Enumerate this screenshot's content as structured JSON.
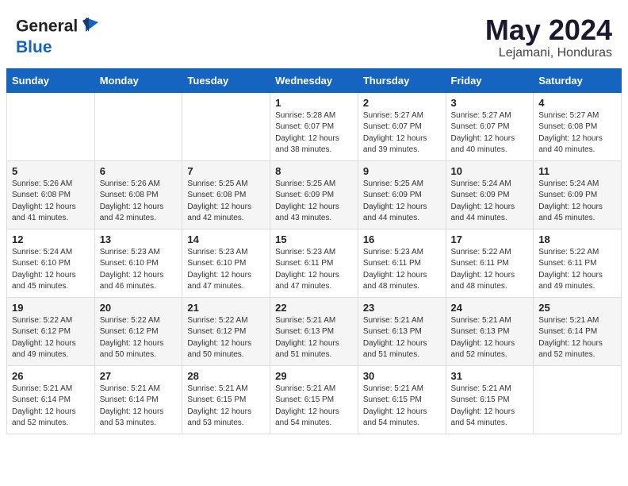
{
  "header": {
    "logo_line1": "General",
    "logo_line2": "Blue",
    "month_title": "May 2024",
    "location": "Lejamani, Honduras"
  },
  "weekdays": [
    "Sunday",
    "Monday",
    "Tuesday",
    "Wednesday",
    "Thursday",
    "Friday",
    "Saturday"
  ],
  "weeks": [
    [
      {
        "day": "",
        "sunrise": "",
        "sunset": "",
        "daylight": ""
      },
      {
        "day": "",
        "sunrise": "",
        "sunset": "",
        "daylight": ""
      },
      {
        "day": "",
        "sunrise": "",
        "sunset": "",
        "daylight": ""
      },
      {
        "day": "1",
        "sunrise": "Sunrise: 5:28 AM",
        "sunset": "Sunset: 6:07 PM",
        "daylight": "Daylight: 12 hours and 38 minutes."
      },
      {
        "day": "2",
        "sunrise": "Sunrise: 5:27 AM",
        "sunset": "Sunset: 6:07 PM",
        "daylight": "Daylight: 12 hours and 39 minutes."
      },
      {
        "day": "3",
        "sunrise": "Sunrise: 5:27 AM",
        "sunset": "Sunset: 6:07 PM",
        "daylight": "Daylight: 12 hours and 40 minutes."
      },
      {
        "day": "4",
        "sunrise": "Sunrise: 5:27 AM",
        "sunset": "Sunset: 6:08 PM",
        "daylight": "Daylight: 12 hours and 40 minutes."
      }
    ],
    [
      {
        "day": "5",
        "sunrise": "Sunrise: 5:26 AM",
        "sunset": "Sunset: 6:08 PM",
        "daylight": "Daylight: 12 hours and 41 minutes."
      },
      {
        "day": "6",
        "sunrise": "Sunrise: 5:26 AM",
        "sunset": "Sunset: 6:08 PM",
        "daylight": "Daylight: 12 hours and 42 minutes."
      },
      {
        "day": "7",
        "sunrise": "Sunrise: 5:25 AM",
        "sunset": "Sunset: 6:08 PM",
        "daylight": "Daylight: 12 hours and 42 minutes."
      },
      {
        "day": "8",
        "sunrise": "Sunrise: 5:25 AM",
        "sunset": "Sunset: 6:09 PM",
        "daylight": "Daylight: 12 hours and 43 minutes."
      },
      {
        "day": "9",
        "sunrise": "Sunrise: 5:25 AM",
        "sunset": "Sunset: 6:09 PM",
        "daylight": "Daylight: 12 hours and 44 minutes."
      },
      {
        "day": "10",
        "sunrise": "Sunrise: 5:24 AM",
        "sunset": "Sunset: 6:09 PM",
        "daylight": "Daylight: 12 hours and 44 minutes."
      },
      {
        "day": "11",
        "sunrise": "Sunrise: 5:24 AM",
        "sunset": "Sunset: 6:09 PM",
        "daylight": "Daylight: 12 hours and 45 minutes."
      }
    ],
    [
      {
        "day": "12",
        "sunrise": "Sunrise: 5:24 AM",
        "sunset": "Sunset: 6:10 PM",
        "daylight": "Daylight: 12 hours and 45 minutes."
      },
      {
        "day": "13",
        "sunrise": "Sunrise: 5:23 AM",
        "sunset": "Sunset: 6:10 PM",
        "daylight": "Daylight: 12 hours and 46 minutes."
      },
      {
        "day": "14",
        "sunrise": "Sunrise: 5:23 AM",
        "sunset": "Sunset: 6:10 PM",
        "daylight": "Daylight: 12 hours and 47 minutes."
      },
      {
        "day": "15",
        "sunrise": "Sunrise: 5:23 AM",
        "sunset": "Sunset: 6:11 PM",
        "daylight": "Daylight: 12 hours and 47 minutes."
      },
      {
        "day": "16",
        "sunrise": "Sunrise: 5:23 AM",
        "sunset": "Sunset: 6:11 PM",
        "daylight": "Daylight: 12 hours and 48 minutes."
      },
      {
        "day": "17",
        "sunrise": "Sunrise: 5:22 AM",
        "sunset": "Sunset: 6:11 PM",
        "daylight": "Daylight: 12 hours and 48 minutes."
      },
      {
        "day": "18",
        "sunrise": "Sunrise: 5:22 AM",
        "sunset": "Sunset: 6:11 PM",
        "daylight": "Daylight: 12 hours and 49 minutes."
      }
    ],
    [
      {
        "day": "19",
        "sunrise": "Sunrise: 5:22 AM",
        "sunset": "Sunset: 6:12 PM",
        "daylight": "Daylight: 12 hours and 49 minutes."
      },
      {
        "day": "20",
        "sunrise": "Sunrise: 5:22 AM",
        "sunset": "Sunset: 6:12 PM",
        "daylight": "Daylight: 12 hours and 50 minutes."
      },
      {
        "day": "21",
        "sunrise": "Sunrise: 5:22 AM",
        "sunset": "Sunset: 6:12 PM",
        "daylight": "Daylight: 12 hours and 50 minutes."
      },
      {
        "day": "22",
        "sunrise": "Sunrise: 5:21 AM",
        "sunset": "Sunset: 6:13 PM",
        "daylight": "Daylight: 12 hours and 51 minutes."
      },
      {
        "day": "23",
        "sunrise": "Sunrise: 5:21 AM",
        "sunset": "Sunset: 6:13 PM",
        "daylight": "Daylight: 12 hours and 51 minutes."
      },
      {
        "day": "24",
        "sunrise": "Sunrise: 5:21 AM",
        "sunset": "Sunset: 6:13 PM",
        "daylight": "Daylight: 12 hours and 52 minutes."
      },
      {
        "day": "25",
        "sunrise": "Sunrise: 5:21 AM",
        "sunset": "Sunset: 6:14 PM",
        "daylight": "Daylight: 12 hours and 52 minutes."
      }
    ],
    [
      {
        "day": "26",
        "sunrise": "Sunrise: 5:21 AM",
        "sunset": "Sunset: 6:14 PM",
        "daylight": "Daylight: 12 hours and 52 minutes."
      },
      {
        "day": "27",
        "sunrise": "Sunrise: 5:21 AM",
        "sunset": "Sunset: 6:14 PM",
        "daylight": "Daylight: 12 hours and 53 minutes."
      },
      {
        "day": "28",
        "sunrise": "Sunrise: 5:21 AM",
        "sunset": "Sunset: 6:15 PM",
        "daylight": "Daylight: 12 hours and 53 minutes."
      },
      {
        "day": "29",
        "sunrise": "Sunrise: 5:21 AM",
        "sunset": "Sunset: 6:15 PM",
        "daylight": "Daylight: 12 hours and 54 minutes."
      },
      {
        "day": "30",
        "sunrise": "Sunrise: 5:21 AM",
        "sunset": "Sunset: 6:15 PM",
        "daylight": "Daylight: 12 hours and 54 minutes."
      },
      {
        "day": "31",
        "sunrise": "Sunrise: 5:21 AM",
        "sunset": "Sunset: 6:15 PM",
        "daylight": "Daylight: 12 hours and 54 minutes."
      },
      {
        "day": "",
        "sunrise": "",
        "sunset": "",
        "daylight": ""
      }
    ]
  ]
}
